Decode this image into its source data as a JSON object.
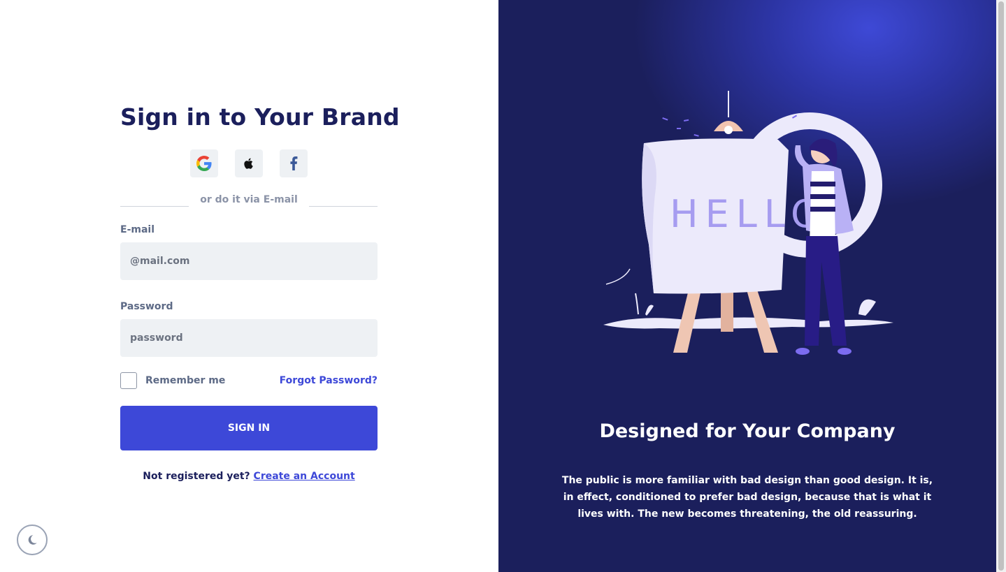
{
  "signin": {
    "title": "Sign in to Your Brand",
    "divider_text": "or do it via E-mail",
    "email_label": "E-mail",
    "email_placeholder": "@mail.com",
    "password_label": "Password",
    "password_placeholder": "password",
    "remember_label": "Remember me",
    "forgot_label": "Forgot Password?",
    "submit_label": "SIGN IN",
    "register_prompt": "Not registered yet?",
    "register_link": "Create an Account"
  },
  "social": [
    {
      "icon": "google-icon"
    },
    {
      "icon": "apple-icon"
    },
    {
      "icon": "facebook-icon"
    }
  ],
  "promo": {
    "illustration_text": "HELLO",
    "title": "Designed for Your Company",
    "text": "The public is more familiar with bad design than good design. It is, in effect, conditioned to prefer bad design, because that is what it lives with. The new becomes threatening, the old reassuring."
  },
  "colors": {
    "primary": "#3d48d8",
    "dark": "#1b1f5c",
    "input_bg": "#eef1f4",
    "muted_text": "#5d6a86"
  }
}
